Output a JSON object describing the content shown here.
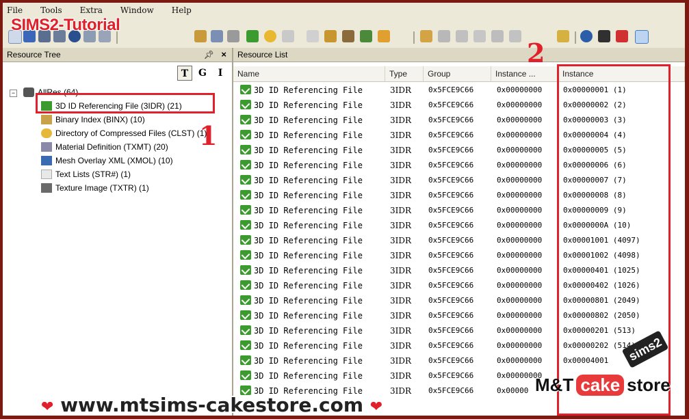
{
  "menu": [
    "File",
    "Tools",
    "Extra",
    "Window",
    "Help"
  ],
  "watermark_top": "SIMS2-Tutorial",
  "left_pane": {
    "title": "Resource Tree",
    "pin_icon": "pin-icon",
    "close_label": "×",
    "view_buttons": [
      {
        "label": "T",
        "active": true
      },
      {
        "label": "G",
        "active": false
      },
      {
        "label": "I",
        "active": false
      }
    ],
    "root": "AllRes (64)",
    "items": [
      {
        "label": "3D ID Referencing File (3IDR) (21)",
        "icon": "green-check-icon",
        "color": "#3c9b2e"
      },
      {
        "label": "Binary Index (BINX) (10)",
        "icon": "binary-index-icon",
        "color": "#c9a14a"
      },
      {
        "label": "Directory of Compressed Files (CLST) (1)",
        "icon": "directory-icon",
        "color": "#e6b83a"
      },
      {
        "label": "Material Definition (TXMT) (20)",
        "icon": "material-icon",
        "color": "#8a8aa8"
      },
      {
        "label": "Mesh Overlay XML (XMOL) (10)",
        "icon": "mesh-icon",
        "color": "#3a6bb0"
      },
      {
        "label": "Text Lists (STR#) (1)",
        "icon": "text-list-icon",
        "color": "#b0b0b0"
      },
      {
        "label": "Texture Image (TXTR) (1)",
        "icon": "texture-icon",
        "color": "#6a6a6a"
      }
    ]
  },
  "right_pane": {
    "title": "Resource List",
    "columns": [
      "Name",
      "Type",
      "Group",
      "Instance ...",
      "Instance"
    ],
    "rows": [
      {
        "name": "3D ID Referencing File",
        "type": "3IDR",
        "group": "0x5FCE9C66",
        "instance_hi": "0x00000000",
        "instance": "0x00000001  (1)"
      },
      {
        "name": "3D ID Referencing File",
        "type": "3IDR",
        "group": "0x5FCE9C66",
        "instance_hi": "0x00000000",
        "instance": "0x00000002  (2)"
      },
      {
        "name": "3D ID Referencing File",
        "type": "3IDR",
        "group": "0x5FCE9C66",
        "instance_hi": "0x00000000",
        "instance": "0x00000003  (3)"
      },
      {
        "name": "3D ID Referencing File",
        "type": "3IDR",
        "group": "0x5FCE9C66",
        "instance_hi": "0x00000000",
        "instance": "0x00000004  (4)"
      },
      {
        "name": "3D ID Referencing File",
        "type": "3IDR",
        "group": "0x5FCE9C66",
        "instance_hi": "0x00000000",
        "instance": "0x00000005  (5)"
      },
      {
        "name": "3D ID Referencing File",
        "type": "3IDR",
        "group": "0x5FCE9C66",
        "instance_hi": "0x00000000",
        "instance": "0x00000006  (6)"
      },
      {
        "name": "3D ID Referencing File",
        "type": "3IDR",
        "group": "0x5FCE9C66",
        "instance_hi": "0x00000000",
        "instance": "0x00000007  (7)"
      },
      {
        "name": "3D ID Referencing File",
        "type": "3IDR",
        "group": "0x5FCE9C66",
        "instance_hi": "0x00000000",
        "instance": "0x00000008  (8)"
      },
      {
        "name": "3D ID Referencing File",
        "type": "3IDR",
        "group": "0x5FCE9C66",
        "instance_hi": "0x00000000",
        "instance": "0x00000009  (9)"
      },
      {
        "name": "3D ID Referencing File",
        "type": "3IDR",
        "group": "0x5FCE9C66",
        "instance_hi": "0x00000000",
        "instance": "0x0000000A  (10)"
      },
      {
        "name": "3D ID Referencing File",
        "type": "3IDR",
        "group": "0x5FCE9C66",
        "instance_hi": "0x00000000",
        "instance": "0x00001001  (4097)"
      },
      {
        "name": "3D ID Referencing File",
        "type": "3IDR",
        "group": "0x5FCE9C66",
        "instance_hi": "0x00000000",
        "instance": "0x00001002  (4098)"
      },
      {
        "name": "3D ID Referencing File",
        "type": "3IDR",
        "group": "0x5FCE9C66",
        "instance_hi": "0x00000000",
        "instance": "0x00000401  (1025)"
      },
      {
        "name": "3D ID Referencing File",
        "type": "3IDR",
        "group": "0x5FCE9C66",
        "instance_hi": "0x00000000",
        "instance": "0x00000402  (1026)"
      },
      {
        "name": "3D ID Referencing File",
        "type": "3IDR",
        "group": "0x5FCE9C66",
        "instance_hi": "0x00000000",
        "instance": "0x00000801  (2049)"
      },
      {
        "name": "3D ID Referencing File",
        "type": "3IDR",
        "group": "0x5FCE9C66",
        "instance_hi": "0x00000000",
        "instance": "0x00000802  (2050)"
      },
      {
        "name": "3D ID Referencing File",
        "type": "3IDR",
        "group": "0x5FCE9C66",
        "instance_hi": "0x00000000",
        "instance": "0x00000201  (513)"
      },
      {
        "name": "3D ID Referencing File",
        "type": "3IDR",
        "group": "0x5FCE9C66",
        "instance_hi": "0x00000000",
        "instance": "0x00000202  (514)"
      },
      {
        "name": "3D ID Referencing File",
        "type": "3IDR",
        "group": "0x5FCE9C66",
        "instance_hi": "0x00000000",
        "instance": "0x00004001"
      },
      {
        "name": "3D ID Referencing File",
        "type": "3IDR",
        "group": "0x5FCE9C66",
        "instance_hi": "0x00000000",
        "instance": ""
      },
      {
        "name": "3D ID Referencing File",
        "type": "3IDR",
        "group": "0x5FCE9C66",
        "instance_hi": "0x00000",
        "instance": ""
      }
    ]
  },
  "annotations": {
    "marker_1": "1",
    "marker_2": "2",
    "color": "#e0202a"
  },
  "site_watermark": "www.mtsims-cakestore.com",
  "brand": {
    "mt": "M&T",
    "cake": "cake",
    "store": "store",
    "seal": "sims2"
  }
}
